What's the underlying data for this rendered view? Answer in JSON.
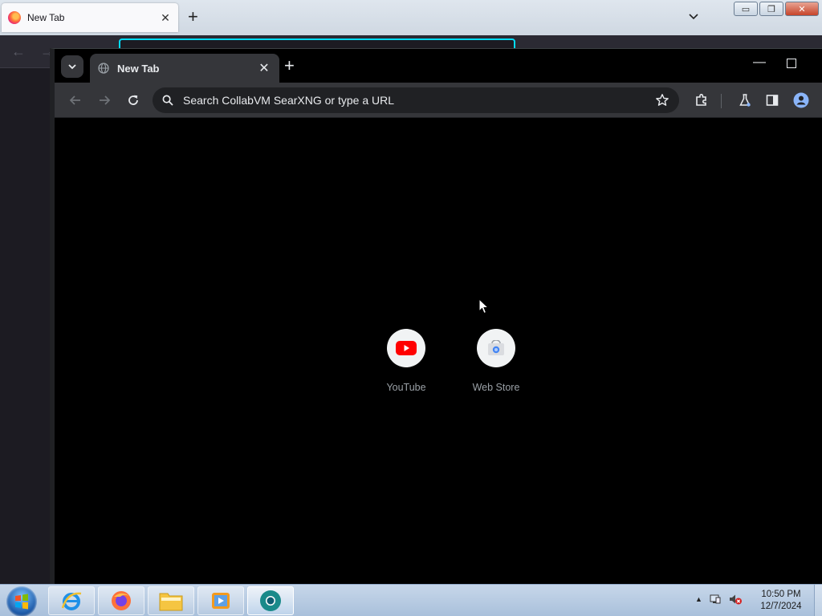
{
  "firefox": {
    "tab_title": "New Tab",
    "tab_close": "✕",
    "new_tab": "+",
    "window_buttons": {
      "minimize": "▭",
      "restore": "❐",
      "close": "✕"
    }
  },
  "chrome": {
    "tab_title": "New Tab",
    "tab_close": "✕",
    "new_tab": "+",
    "minimize": "—",
    "omnibox_placeholder": "Search CollabVM SearXNG or type a URL",
    "shortcuts": [
      {
        "label": "YouTube",
        "icon": "youtube-icon"
      },
      {
        "label": "Web Store",
        "icon": "web-store-icon"
      }
    ]
  },
  "taskbar": {
    "apps": [
      "internet-explorer-icon",
      "firefox-icon",
      "file-explorer-icon",
      "media-player-icon",
      "chrome-beta-icon"
    ],
    "clock_time": "10:50 PM",
    "clock_date": "12/7/2024"
  },
  "colors": {
    "chrome_toolbar": "#35363a",
    "chrome_omnibox": "#202124",
    "youtube_red": "#ff0000",
    "firefox_focus_ring": "#00ddff"
  }
}
